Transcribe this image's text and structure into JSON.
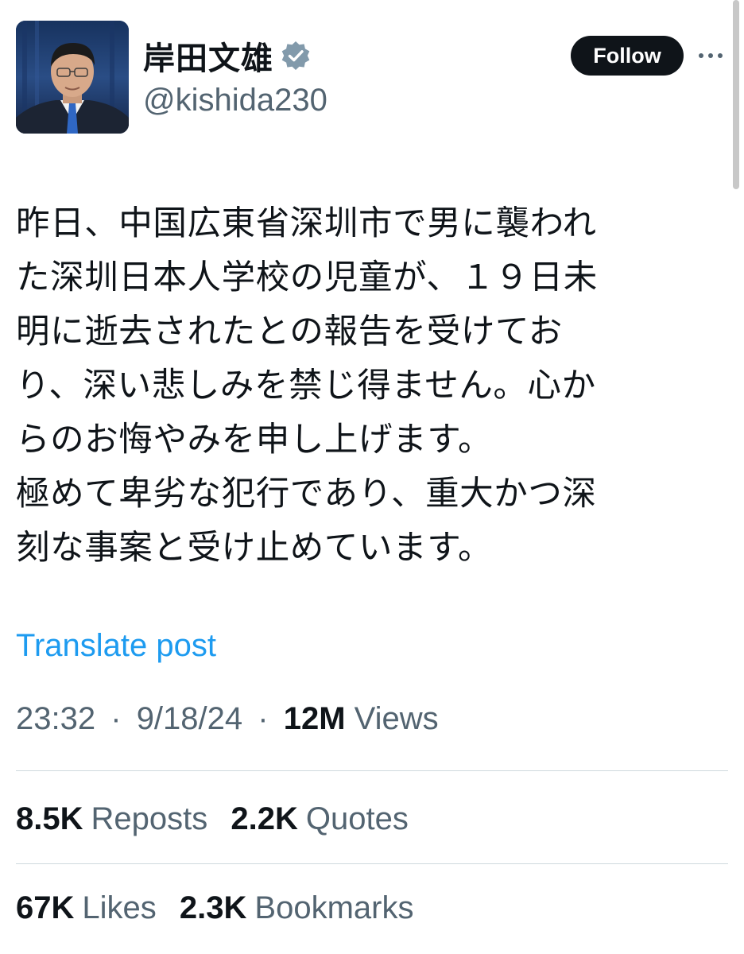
{
  "author": {
    "display_name": "岸田文雄",
    "handle": "@kishida230",
    "verified": true,
    "verified_color": "#829aab"
  },
  "actions": {
    "follow_label": "Follow",
    "more_icon": "more-horizontal-icon"
  },
  "post": {
    "lines": [
      "昨日、中国広東省深圳市で男に襲われ",
      "た深圳日本人学校の児童が、１９日未",
      "明に逝去されたとの報告を受けてお",
      "り、深い悲しみを禁じ得ません。心か",
      "らのお悔やみを申し上げます。",
      "極めて卑劣な犯行であり、重大かつ深",
      "刻な事案と受け止めています。"
    ],
    "translate_label": "Translate post"
  },
  "meta": {
    "time": "23:32",
    "separator": "·",
    "date": "9/18/24",
    "views_count": "12M",
    "views_label": "Views"
  },
  "stats": {
    "reposts": {
      "count": "8.5K",
      "label": "Reposts"
    },
    "quotes": {
      "count": "2.2K",
      "label": "Quotes"
    },
    "likes": {
      "count": "67K",
      "label": "Likes"
    },
    "bookmarks": {
      "count": "2.3K",
      "label": "Bookmarks"
    }
  },
  "colors": {
    "text": "#0f1419",
    "secondary": "#536471",
    "link": "#1d9bf0",
    "divider": "#cfd9de",
    "button_bg": "#0f1419"
  }
}
